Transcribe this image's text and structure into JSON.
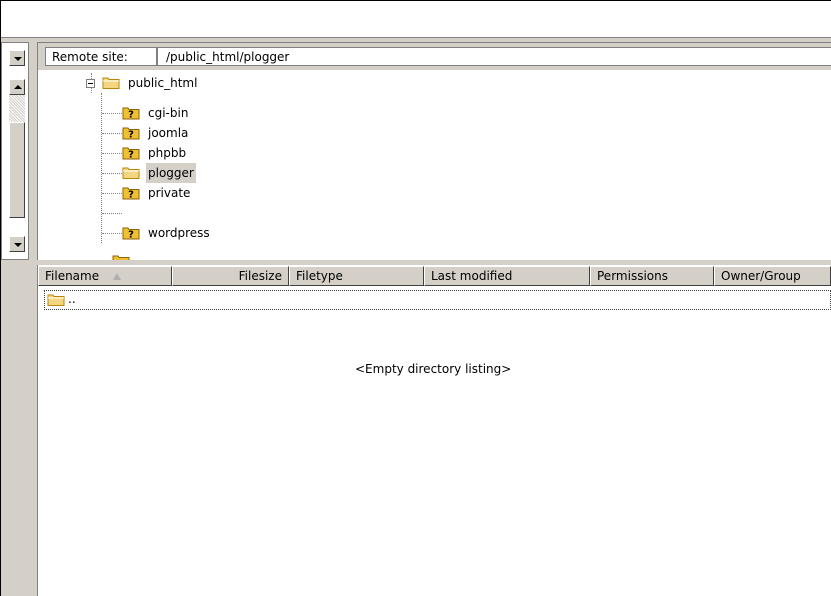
{
  "remote_site": {
    "label": "Remote site:",
    "path": "/public_html/plogger"
  },
  "tree": {
    "root": "public_html",
    "children": [
      "cgi-bin",
      "joomla",
      "phpbb",
      "plogger",
      "private",
      "wordpress"
    ],
    "selected": "plogger"
  },
  "list": {
    "columns": {
      "filename": "Filename",
      "filesize": "Filesize",
      "filetype": "Filetype",
      "last_modified": "Last modified",
      "permissions": "Permissions",
      "owner_group": "Owner/Group"
    },
    "parent_entry": "..",
    "empty_message": "<Empty directory listing>"
  },
  "colors": {
    "chrome": "#d4d0c8",
    "folder": "#f5d680",
    "folder_outline": "#b8860b",
    "unknown_icon": "#f0c030"
  },
  "icons": {
    "folder": "folder-icon",
    "unknown_folder": "unknown-folder-icon",
    "sort": "sort-ascending-icon",
    "scroll_down": "scroll-down-arrow",
    "scroll_up": "scroll-up-arrow",
    "expander": "collapse-icon"
  }
}
